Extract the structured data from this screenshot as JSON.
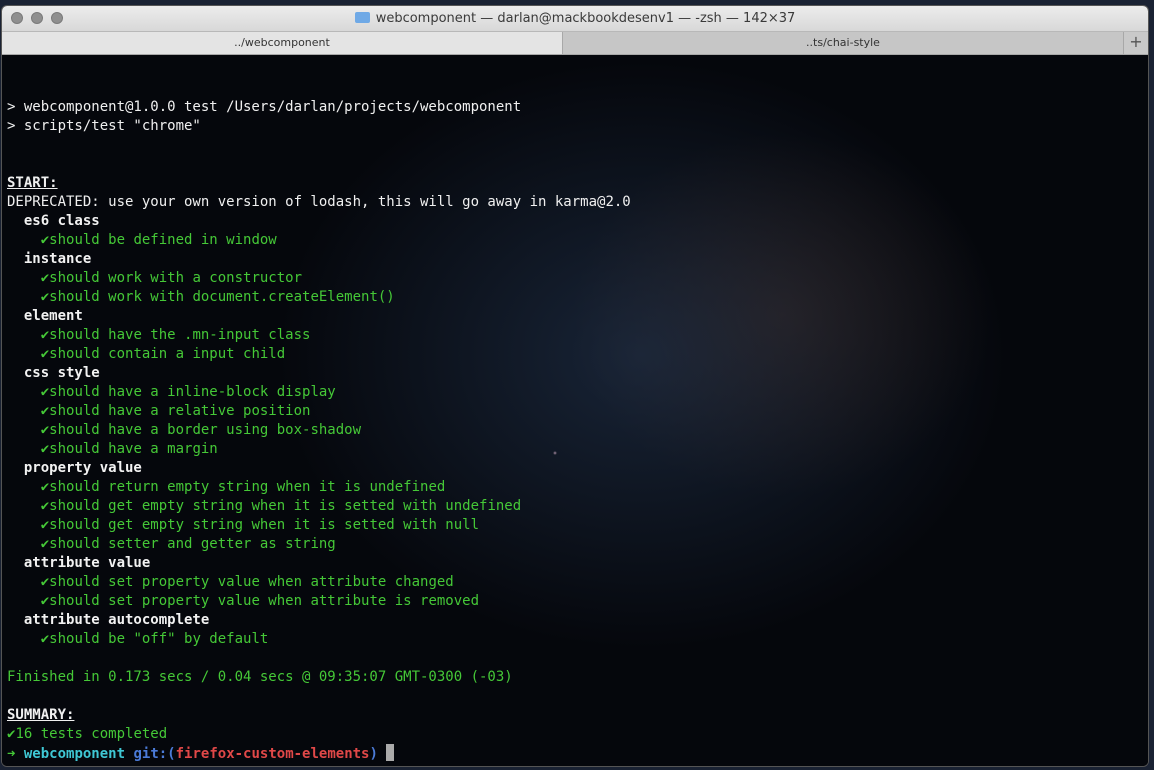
{
  "window": {
    "title": "webcomponent — darlan@mackbookdesenv1 — -zsh — 142×37"
  },
  "tabs": [
    {
      "label": "../webcomponent"
    },
    {
      "label": "..ts/chai-style"
    }
  ],
  "tab_add_label": "+",
  "terminal": {
    "cmd1": "> webcomponent@1.0.0 test /Users/darlan/projects/webcomponent",
    "cmd2": "> scripts/test \"chrome\"",
    "start": "START:",
    "deprecated": "DEPRECATED: use your own version of lodash, this will go away in karma@2.0",
    "check": "✔",
    "groups": [
      {
        "name": "es6 class",
        "tests": [
          "should be defined in window"
        ]
      },
      {
        "name": "instance",
        "tests": [
          "should work with a constructor",
          "should work with document.createElement()"
        ]
      },
      {
        "name": "element",
        "tests": [
          "should have the .mn-input class",
          "should contain a input child"
        ]
      },
      {
        "name": "css style",
        "tests": [
          "should have a inline-block display",
          "should have a relative position",
          "should have a border using box-shadow",
          "should have a margin"
        ]
      },
      {
        "name": "property value",
        "tests": [
          "should return empty string when it is undefined",
          "should get empty string when it is setted with undefined",
          "should get empty string when it is setted with null",
          "should setter and getter as string"
        ]
      },
      {
        "name": "attribute value",
        "tests": [
          "should set property value when attribute changed",
          "should set property value when attribute is removed"
        ]
      },
      {
        "name": "attribute autocomplete",
        "tests": [
          "should be \"off\" by default"
        ]
      }
    ],
    "finished": "Finished in 0.173 secs / 0.04 secs @ 09:35:07 GMT-0300 (-03)",
    "summary": "SUMMARY:",
    "completed": "16 tests completed",
    "prompt": {
      "arrow": "➜",
      "dir": "webcomponent",
      "git_prefix": "git:(",
      "branch": "firefox-custom-elements",
      "git_suffix": ")"
    }
  }
}
